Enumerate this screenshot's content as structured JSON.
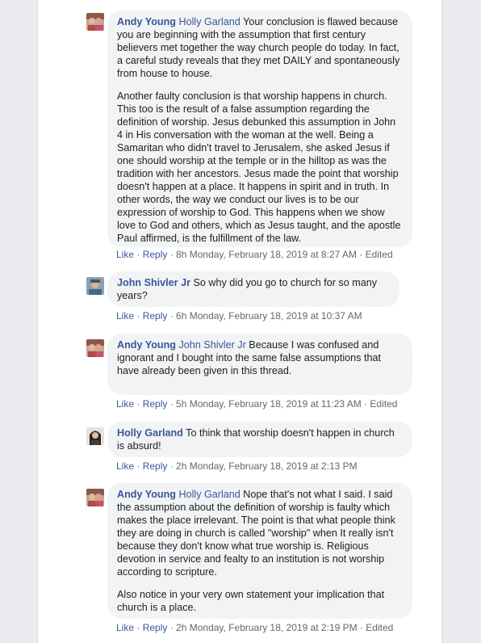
{
  "sep": " · ",
  "comments": [
    {
      "author": "Andy Young",
      "mention": "Holly Garland",
      "paragraphs": [
        "Your conclusion is flawed because you are beginning with the assumption that first century believers met together the way church people do today. In fact, a careful study reveals that they met DAILY and spontaneously from house to house.",
        "Another faulty conclusion is that worship happens in church. This too is the result of a false assumption regarding the definition of worship. Jesus debunked this assumption in John 4 in His conversation with the woman at the well. Being a Samaritan who didn't travel to Jerusalem, she asked Jesus if one should worship at the temple or in the hilltop as was the tradition with her ancestors. Jesus made the point that worship doesn't happen at a place. It happens in spirit and in truth. In other words, the way we conduct our lives is to be our expression of worship to God. This happens when we show love to God and others, which as Jesus taught, and the apostle Paul affirmed, is the fulfillment of the law."
      ],
      "like": "Like",
      "reply": "Reply",
      "time": "8h Monday, February 18, 2019 at 8:27 AM",
      "edited": "Edited",
      "avatar_bg": "#b04848"
    },
    {
      "author": "John Shivler Jr",
      "text": "So why did you go to church for so many years?",
      "like": "Like",
      "reply": "Reply",
      "time": "6h Monday, February 18, 2019 at 10:37 AM",
      "avatar_bg": "#6a7f92"
    },
    {
      "author": "Andy Young",
      "mention": "John Shivler Jr",
      "text": "Because I was confused and ignorant and I bought into the same false assumptions that have already been given in this thread.",
      "like": "Like",
      "reply": "Reply",
      "time": "5h Monday, February 18, 2019 at 11:23 AM",
      "edited": "Edited",
      "avatar_bg": "#b04848"
    },
    {
      "author": "Holly Garland",
      "text": "To think that worship doesn't happen in church is absurd!",
      "like": "Like",
      "reply": "Reply",
      "time": "2h Monday, February 18, 2019 at 2:13 PM",
      "avatar_bg": "#3a3230"
    },
    {
      "author": "Andy Young",
      "mention": "Holly Garland",
      "paragraphs": [
        "Nope that's not what I said. I said the assumption about the definition of worship is faulty which makes the place irrelevant. The point is that what people think they are doing in church is called \"worship\" when It really isn't because they don't know what true worship is. Religious devotion in service and fealty to an institution is not worship according to scripture.",
        "Also notice in your very own statement your implication that church is a place."
      ],
      "like": "Like",
      "reply": "Reply",
      "time": "2h Monday, February 18, 2019 at 2:19 PM",
      "edited": "Edited",
      "avatar_bg": "#b04848"
    }
  ]
}
